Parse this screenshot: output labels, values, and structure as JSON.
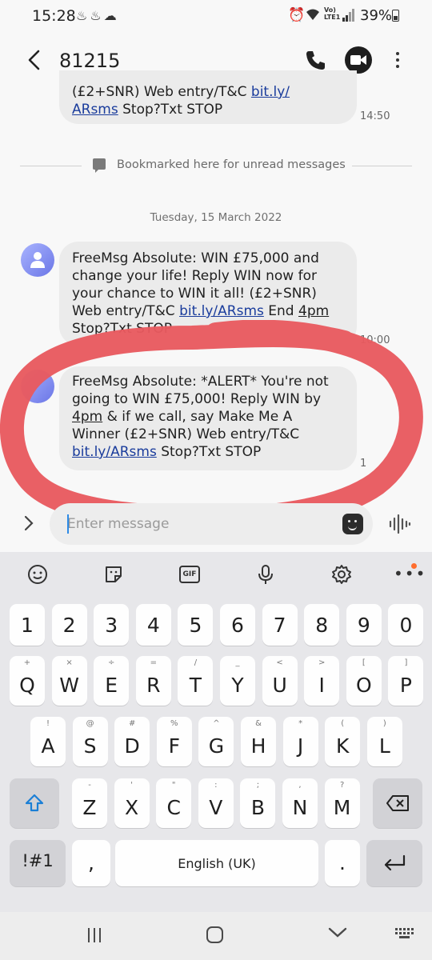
{
  "status_bar": {
    "time": "15:28",
    "battery": "39%",
    "network": "Vo)) LTE1"
  },
  "header": {
    "contact": "81215"
  },
  "messages": [
    {
      "line1": "(£2+SNR) Web entry/T&C ",
      "link1": "bit.ly/",
      "link2": "ARsms",
      "tail": " Stop?Txt STOP",
      "time": "14:50"
    },
    {
      "text_a": "FreeMsg Absolute: WIN £75,000 and change your life! Reply WIN now for your chance to WIN it all! (£2+SNR) Web entry/T&C ",
      "link": "bit.ly/ARsms",
      "text_b": " End ",
      "underline": "4pm",
      "text_c": " Stop?Txt STOP",
      "time": "10:00"
    },
    {
      "text_a": "FreeMsg Absolute: *ALERT* You're not going to WIN £75,000! Reply WIN by ",
      "underline": "4pm",
      "text_b": " & if we call, say Make Me A Winner (£2+SNR) Web entry/T&C ",
      "link": "bit.ly/ARsms",
      "text_c": " Stop?Txt STOP",
      "time": "1"
    }
  ],
  "bookmark": "Bookmarked here for unread messages",
  "date_separator": "Tuesday, 15 March 2022",
  "composer": {
    "placeholder": "Enter message"
  },
  "keyboard": {
    "toolbar_gif": "GIF",
    "number_row": [
      "1",
      "2",
      "3",
      "4",
      "5",
      "6",
      "7",
      "8",
      "9",
      "0"
    ],
    "row1": [
      {
        "k": "Q",
        "h": "+"
      },
      {
        "k": "W",
        "h": "×"
      },
      {
        "k": "E",
        "h": "÷"
      },
      {
        "k": "R",
        "h": "="
      },
      {
        "k": "T",
        "h": "/"
      },
      {
        "k": "Y",
        "h": "_"
      },
      {
        "k": "U",
        "h": "<"
      },
      {
        "k": "I",
        "h": ">"
      },
      {
        "k": "O",
        "h": "["
      },
      {
        "k": "P",
        "h": "]"
      }
    ],
    "row2": [
      {
        "k": "A",
        "h": "!"
      },
      {
        "k": "S",
        "h": "@"
      },
      {
        "k": "D",
        "h": "#"
      },
      {
        "k": "F",
        "h": "%"
      },
      {
        "k": "G",
        "h": "^"
      },
      {
        "k": "H",
        "h": "&"
      },
      {
        "k": "J",
        "h": "*"
      },
      {
        "k": "K",
        "h": "("
      },
      {
        "k": "L",
        "h": ")"
      }
    ],
    "row3": [
      {
        "k": "Z",
        "h": "-"
      },
      {
        "k": "X",
        "h": "'"
      },
      {
        "k": "C",
        "h": "\""
      },
      {
        "k": "V",
        "h": ":"
      },
      {
        "k": "B",
        "h": ";"
      },
      {
        "k": "N",
        "h": ","
      },
      {
        "k": "M",
        "h": "?"
      }
    ],
    "symbols_key": "!#1",
    "comma_key": ",",
    "space_label": "English (UK)",
    "period_key": "."
  },
  "colors": {
    "annotation": "#e85a5f",
    "link": "#1a3c9c",
    "shift": "#1b7fd6"
  }
}
